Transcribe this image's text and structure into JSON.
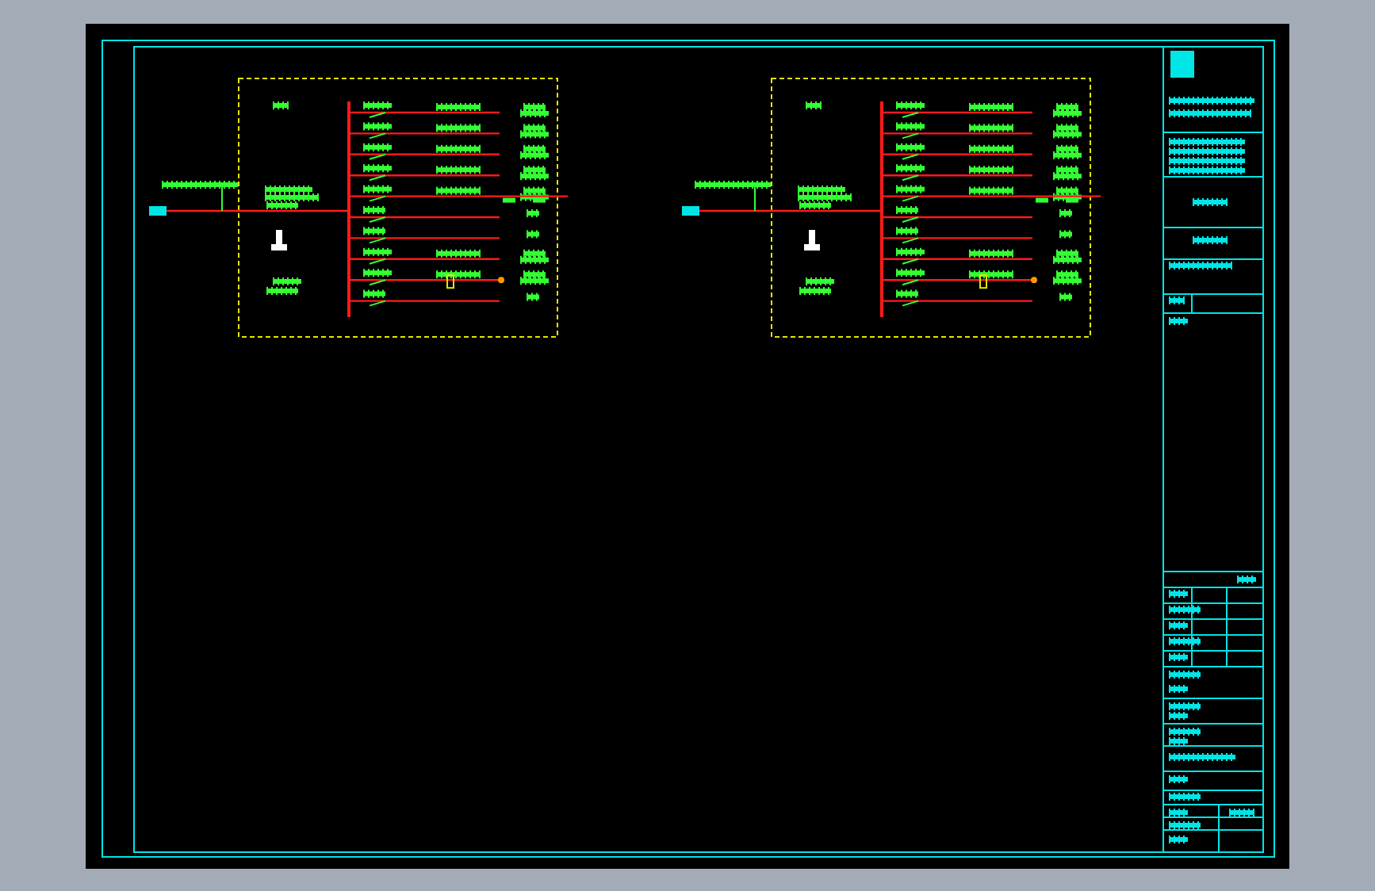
{
  "sheet": {
    "panels": [
      {
        "kind": "distribution-board",
        "circuits": [
          {
            "kind": "feeder"
          },
          {
            "kind": "feeder"
          },
          {
            "kind": "feeder"
          },
          {
            "kind": "feeder"
          },
          {
            "kind": "branch"
          },
          {
            "kind": "spare"
          },
          {
            "kind": "spare"
          },
          {
            "kind": "feeder"
          },
          {
            "kind": "metered"
          },
          {
            "kind": "spare"
          }
        ]
      },
      {
        "kind": "distribution-board",
        "circuits": [
          {
            "kind": "feeder"
          },
          {
            "kind": "feeder"
          },
          {
            "kind": "feeder"
          },
          {
            "kind": "feeder"
          },
          {
            "kind": "branch"
          },
          {
            "kind": "spare"
          },
          {
            "kind": "spare"
          },
          {
            "kind": "feeder"
          },
          {
            "kind": "metered"
          },
          {
            "kind": "spare"
          }
        ]
      }
    ],
    "title_block": {
      "kind": "standard"
    }
  }
}
